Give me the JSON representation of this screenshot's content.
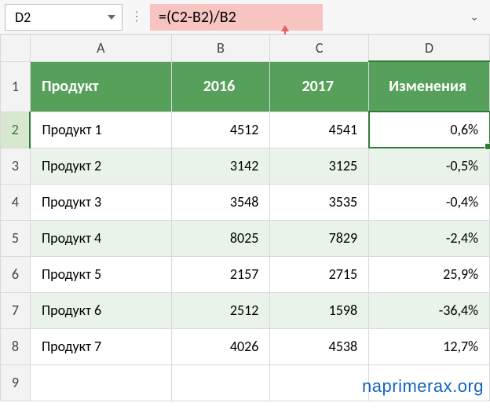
{
  "formula_bar": {
    "cell_ref": "D2",
    "formula": "=(C2-B2)/B2"
  },
  "columns": [
    "A",
    "B",
    "C",
    "D"
  ],
  "headers": {
    "product": "Продукт",
    "y2016": "2016",
    "y2017": "2017",
    "change": "Изменения"
  },
  "rows": [
    {
      "n": "1"
    },
    {
      "n": "2",
      "product": "Продукт 1",
      "y2016": "4512",
      "y2017": "4541",
      "change": "0,6%"
    },
    {
      "n": "3",
      "product": "Продукт 2",
      "y2016": "3142",
      "y2017": "3125",
      "change": "-0,5%"
    },
    {
      "n": "4",
      "product": "Продукт 3",
      "y2016": "3548",
      "y2017": "3535",
      "change": "-0,4%"
    },
    {
      "n": "5",
      "product": "Продукт 4",
      "y2016": "8025",
      "y2017": "7829",
      "change": "-2,4%"
    },
    {
      "n": "6",
      "product": "Продукт 5",
      "y2016": "2157",
      "y2017": "2715",
      "change": "25,9%"
    },
    {
      "n": "7",
      "product": "Продукт 6",
      "y2016": "2512",
      "y2017": "1598",
      "change": "-36,4%"
    },
    {
      "n": "8",
      "product": "Продукт 7",
      "y2016": "4026",
      "y2017": "4538",
      "change": "12,7%"
    },
    {
      "n": "9"
    }
  ],
  "watermark": "naprimerax.org"
}
